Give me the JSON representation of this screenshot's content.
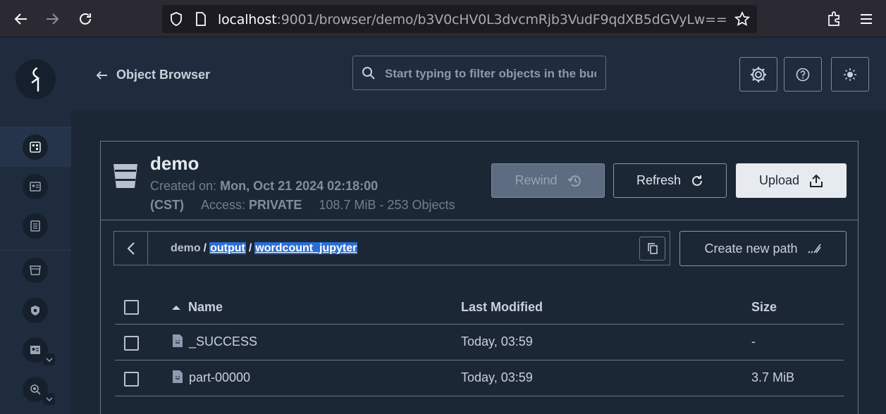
{
  "browser": {
    "url_host": "localhost",
    "url_rest": ":9001/browser/demo/b3V0cHV0L3dvcmRjb3VudF9qdXB5dGVyLw=="
  },
  "header": {
    "back_label": "Object Browser",
    "search_placeholder": "Start typing to filter objects in the bucket"
  },
  "bucket": {
    "name": "demo",
    "created_label": "Created on:",
    "created_value": "Mon, Oct 21 2024 02:18:00",
    "timezone": "(CST)",
    "access_label": "Access:",
    "access_value": "PRIVATE",
    "usage": "108.7 MiB - 253 Objects"
  },
  "actions": {
    "rewind": "Rewind",
    "refresh": "Refresh",
    "upload": "Upload",
    "create_path": "Create new path"
  },
  "breadcrumb": {
    "root": "demo",
    "sep": "/",
    "parts": [
      "output",
      "wordcount_jupyter"
    ]
  },
  "table": {
    "columns": {
      "name": "Name",
      "modified": "Last Modified",
      "size": "Size"
    },
    "rows": [
      {
        "name": "_SUCCESS",
        "modified": "Today, 03:59",
        "size": "-"
      },
      {
        "name": "part-00000",
        "modified": "Today, 03:59",
        "size": "3.7 MiB"
      }
    ]
  },
  "colors": {
    "accent_select": "#2a6dd7",
    "sidebar_bg": "#1e2c3d",
    "content_bg": "#1c2735"
  }
}
